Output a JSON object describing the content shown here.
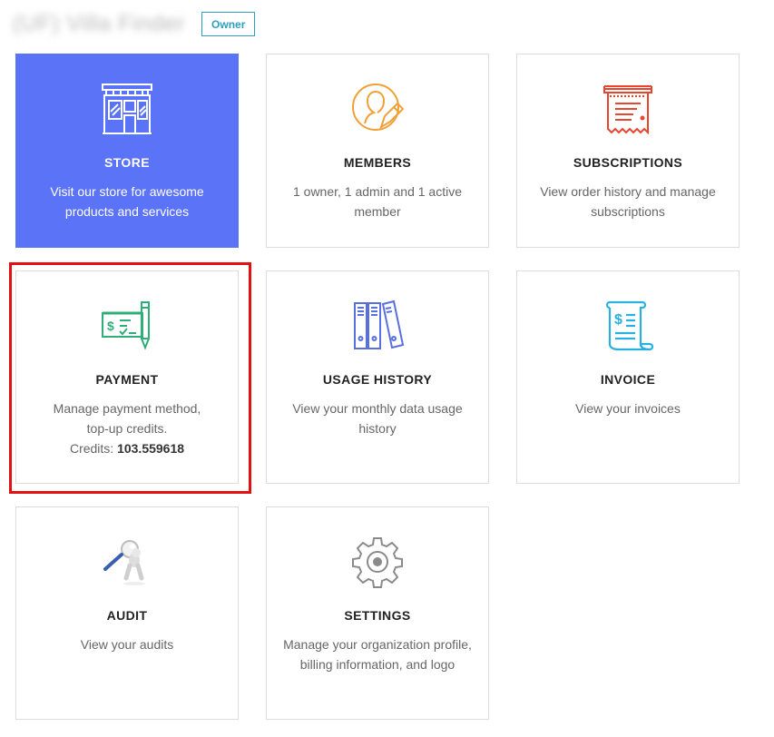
{
  "header": {
    "org_name": "(UF) Villa Finder",
    "role_badge": "Owner"
  },
  "cards": [
    {
      "id": "store",
      "icon": "storefront-icon",
      "title": "STORE",
      "desc": "Visit our store for awesome products and services"
    },
    {
      "id": "members",
      "icon": "user-edit-icon",
      "title": "MEMBERS",
      "desc": "1 owner, 1 admin and 1 active member"
    },
    {
      "id": "subscriptions",
      "icon": "receipt-icon",
      "title": "SUBSCRIPTIONS",
      "desc": "View order history and manage subscriptions"
    },
    {
      "id": "payment",
      "icon": "check-payment-icon",
      "title": "PAYMENT",
      "desc_line1": "Manage payment method,",
      "desc_line2": "top-up credits.",
      "credits_label": "Credits:",
      "credits_value": "103.559618"
    },
    {
      "id": "usage-history",
      "icon": "binders-icon",
      "title": "USAGE HISTORY",
      "desc": "View your monthly data usage history"
    },
    {
      "id": "invoice",
      "icon": "invoice-scroll-icon",
      "title": "INVOICE",
      "desc": "View your invoices"
    },
    {
      "id": "audit",
      "icon": "magnifier-person-icon",
      "title": "AUDIT",
      "desc": "View your audits"
    },
    {
      "id": "settings",
      "icon": "gear-icon",
      "title": "SETTINGS",
      "desc": "Manage your organization profile, billing information, and logo"
    }
  ],
  "colors": {
    "store_bg": "#5b73f7",
    "badge": "#2aa1bf",
    "highlight": "#e31010"
  }
}
